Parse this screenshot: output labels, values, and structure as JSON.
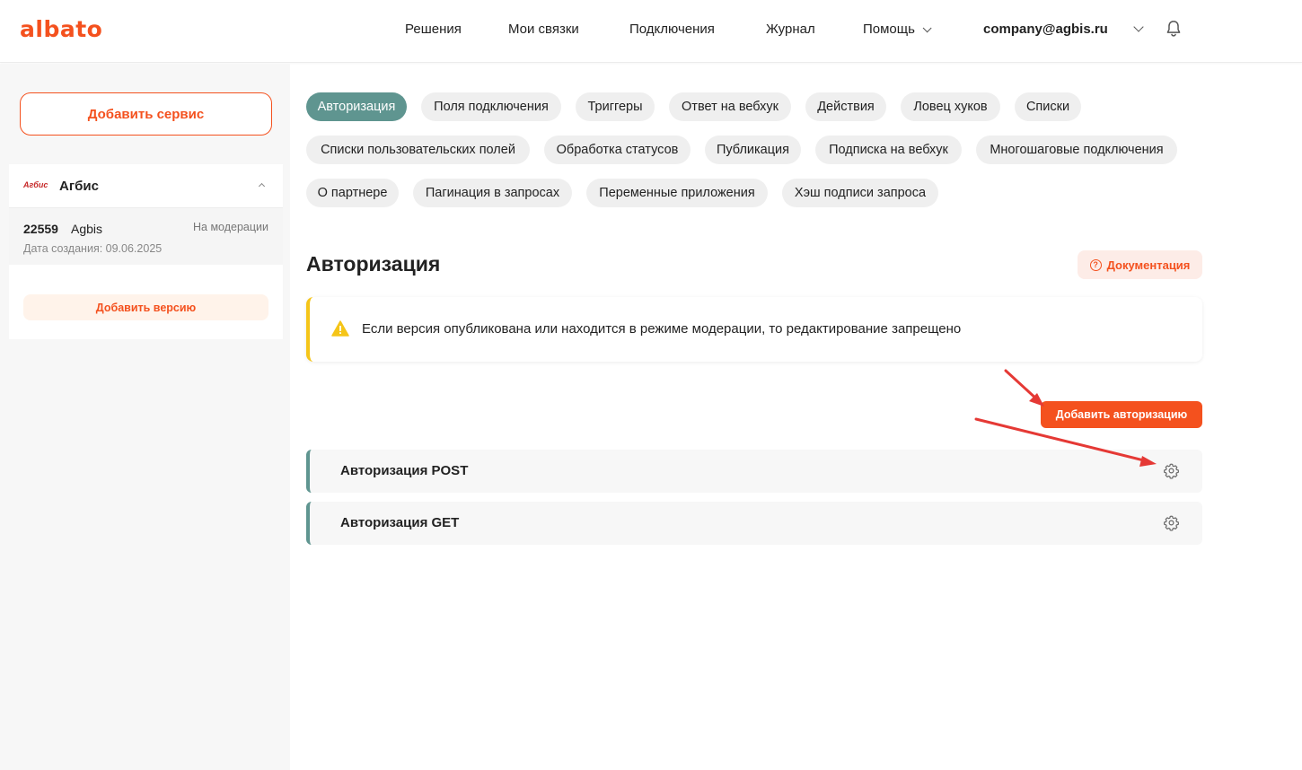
{
  "header": {
    "logo": "albato",
    "nav": [
      "Решения",
      "Мои связки",
      "Подключения",
      "Журнал",
      "Помощь"
    ],
    "user_email": "company@agbis.ru"
  },
  "sidebar": {
    "add_service_label": "Добавить сервис",
    "service": {
      "logo_text": "Агбис",
      "name": "Агбис",
      "version": {
        "id": "22559",
        "name": "Agbis",
        "status": "На модерации",
        "created": "Дата создания: 09.06.2025"
      },
      "add_version_label": "Добавить версию"
    }
  },
  "tabs": [
    "Авторизация",
    "Поля подключения",
    "Триггеры",
    "Ответ на вебхук",
    "Действия",
    "Ловец хуков",
    "Списки",
    "Списки пользовательских полей",
    "Обработка статусов",
    "Публикация",
    "Подписка на вебхук",
    "Многошаговые подключения",
    "О партнере",
    "Пагинация в запросах",
    "Переменные приложения",
    "Хэш подписи запроса"
  ],
  "main": {
    "title": "Авторизация",
    "doc_label": "Документация",
    "alert_text": "Если версия опубликована или находится в режиме модерации, то редактирование запрещено",
    "add_auth_label": "Добавить авторизацию",
    "auth_items": [
      "Авторизация POST",
      "Авторизация GET"
    ]
  },
  "colors": {
    "accent": "#f4511e",
    "active_tab": "#5f9590",
    "warning": "#f5c518",
    "annotation_arrow": "#e53935"
  }
}
